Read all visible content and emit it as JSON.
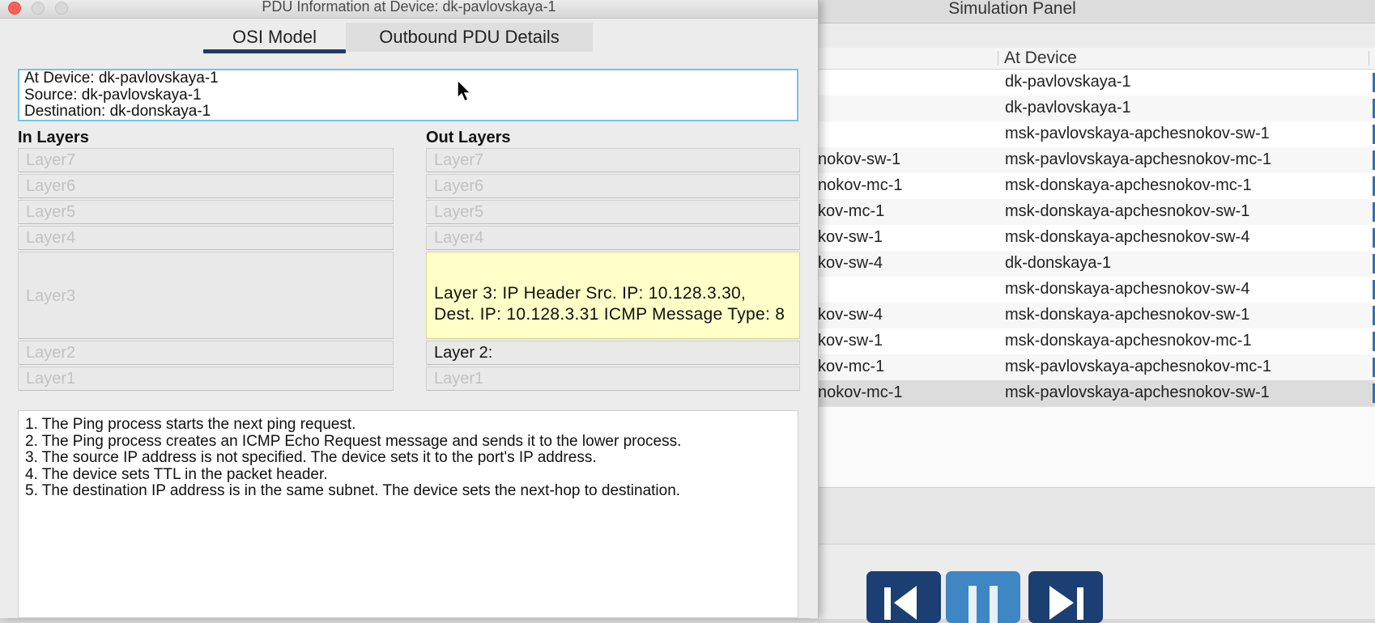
{
  "simulation_panel": {
    "title": "Simulation Panel",
    "column_header": "At Device",
    "rows": [
      {
        "left": "",
        "device": "dk-pavlovskaya-1"
      },
      {
        "left": "",
        "device": "dk-pavlovskaya-1"
      },
      {
        "left": "",
        "device": "msk-pavlovskaya-apchesnokov-sw-1"
      },
      {
        "left": "nokov-sw-1",
        "device": "msk-pavlovskaya-apchesnokov-mc-1"
      },
      {
        "left": "nokov-mc-1",
        "device": "msk-donskaya-apchesnokov-mc-1"
      },
      {
        "left": "kov-mc-1",
        "device": "msk-donskaya-apchesnokov-sw-1"
      },
      {
        "left": "kov-sw-1",
        "device": "msk-donskaya-apchesnokov-sw-4"
      },
      {
        "left": "kov-sw-4",
        "device": "dk-donskaya-1"
      },
      {
        "left": "",
        "device": "msk-donskaya-apchesnokov-sw-4"
      },
      {
        "left": "kov-sw-4",
        "device": "msk-donskaya-apchesnokov-sw-1"
      },
      {
        "left": "kov-sw-1",
        "device": "msk-donskaya-apchesnokov-mc-1"
      },
      {
        "left": "kov-mc-1",
        "device": "msk-pavlovskaya-apchesnokov-mc-1"
      },
      {
        "left": "nokov-mc-1",
        "device": "msk-pavlovskaya-apchesnokov-sw-1"
      }
    ],
    "selected_row": 12,
    "controls": [
      {
        "name": "step-back",
        "icon": "step-back-icon"
      },
      {
        "name": "pause",
        "icon": "pause-icon"
      },
      {
        "name": "step-forward",
        "icon": "step-forward-icon"
      }
    ]
  },
  "dialog": {
    "title": "PDU Information at Device: dk-pavlovskaya-1",
    "tabs": [
      "OSI Model",
      "Outbound PDU Details"
    ],
    "active_tab": 0,
    "info": {
      "at_device": "At Device: dk-pavlovskaya-1",
      "source": "Source: dk-pavlovskaya-1",
      "destination": "Destination: dk-donskaya-1"
    },
    "in_layers": {
      "heading": "In Layers",
      "layers": [
        "Layer7",
        "Layer6",
        "Layer5",
        "Layer4",
        "Layer3",
        "Layer2",
        "Layer1"
      ]
    },
    "out_layers": {
      "heading": "Out Layers",
      "layers": [
        "Layer7",
        "Layer6",
        "Layer5",
        "Layer4",
        "Layer 3: IP Header Src. IP: 10.128.3.30, Dest. IP: 10.128.3.31 ICMP Message Type: 8",
        "Layer 2:",
        "Layer1"
      ]
    },
    "steps": [
      "1. The Ping process starts the next ping request.",
      "2. The Ping process creates an ICMP Echo Request message and sends it to the lower process.",
      "3. The source IP address is not specified. The device sets it to the port's IP address.",
      "4. The device sets TTL in the packet header.",
      "5. The destination IP address is in the same subnet. The device sets the next-hop to destination."
    ]
  },
  "colors": {
    "accent_tab_underline": "#1e3a6b",
    "info_border": "#73c3e6",
    "highlight_layer": "#ffffc8",
    "control_dark": "#1c3f73",
    "control_light": "#3f86c4"
  }
}
